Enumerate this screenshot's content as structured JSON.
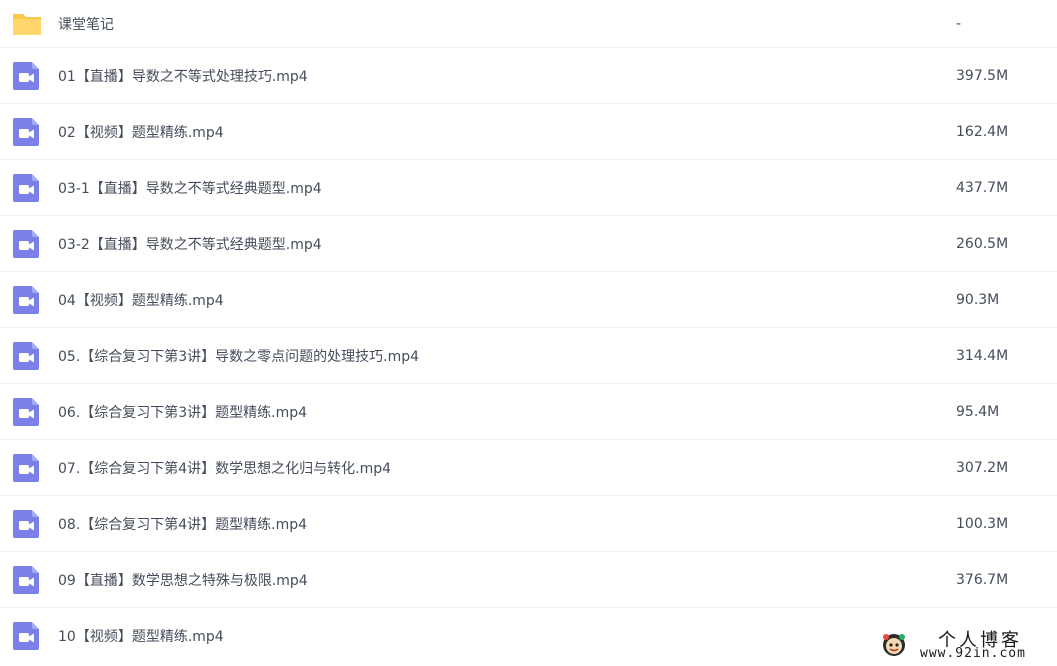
{
  "files": [
    {
      "icon": "folder-icon",
      "name": "课堂笔记",
      "size": "-"
    },
    {
      "icon": "video-file-icon",
      "name": "01【直播】导数之不等式处理技巧.mp4",
      "size": "397.5M"
    },
    {
      "icon": "video-file-icon",
      "name": "02【视频】题型精练.mp4",
      "size": "162.4M"
    },
    {
      "icon": "video-file-icon",
      "name": "03-1【直播】导数之不等式经典题型.mp4",
      "size": "437.7M"
    },
    {
      "icon": "video-file-icon",
      "name": "03-2【直播】导数之不等式经典题型.mp4",
      "size": "260.5M"
    },
    {
      "icon": "video-file-icon",
      "name": "04【视频】题型精练.mp4",
      "size": "90.3M"
    },
    {
      "icon": "video-file-icon",
      "name": "05.【综合复习下第3讲】导数之零点问题的处理技巧.mp4",
      "size": "314.4M"
    },
    {
      "icon": "video-file-icon",
      "name": "06.【综合复习下第3讲】题型精练.mp4",
      "size": "95.4M"
    },
    {
      "icon": "video-file-icon",
      "name": "07.【综合复习下第4讲】数学思想之化归与转化.mp4",
      "size": "307.2M"
    },
    {
      "icon": "video-file-icon",
      "name": "08.【综合复习下第4讲】题型精练.mp4",
      "size": "100.3M"
    },
    {
      "icon": "video-file-icon",
      "name": "09【直播】数学思想之特殊与极限.mp4",
      "size": "376.7M"
    },
    {
      "icon": "video-file-icon",
      "name": "10【视频】题型精练.mp4",
      "size": ""
    }
  ],
  "watermark": {
    "title": "个人博客",
    "url": "www.92in.com",
    "logo_icon": "cartoon-face-logo"
  },
  "colors": {
    "folder": "#fcc84a",
    "video_icon": "#7b7fe8",
    "text": "#454d5a",
    "divider": "#eef0f3"
  }
}
